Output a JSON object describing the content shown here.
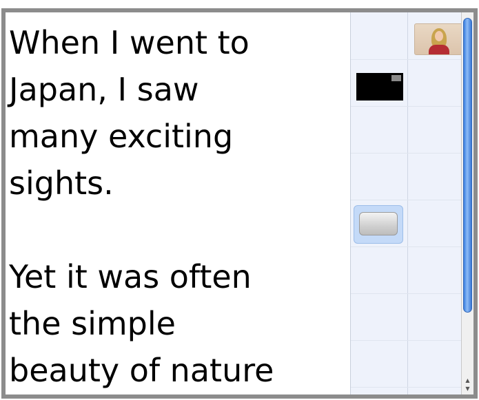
{
  "text_pane": {
    "paragraphs": [
      "When I went to\nJapan, I saw\nmany exciting\nsights.",
      "Yet it was often\nthe simple\nbeauty of nature"
    ]
  },
  "grid": {
    "columns": 2,
    "items": [
      {
        "name": "person-thumbnail",
        "column": 2,
        "row": 1
      },
      {
        "name": "black-video-thumbnail",
        "column": 1,
        "row": 2
      },
      {
        "name": "gray-button-item",
        "column": 1,
        "row": 5,
        "selected": true
      }
    ]
  },
  "scrollbar": {
    "up_arrow": "▲",
    "down_arrow": "▼"
  },
  "colors": {
    "frame": "#8c8c8c",
    "grid_background": "#eef2fb",
    "selection": "#c4daf8",
    "scroll_thumb": "#3b7fe0"
  }
}
